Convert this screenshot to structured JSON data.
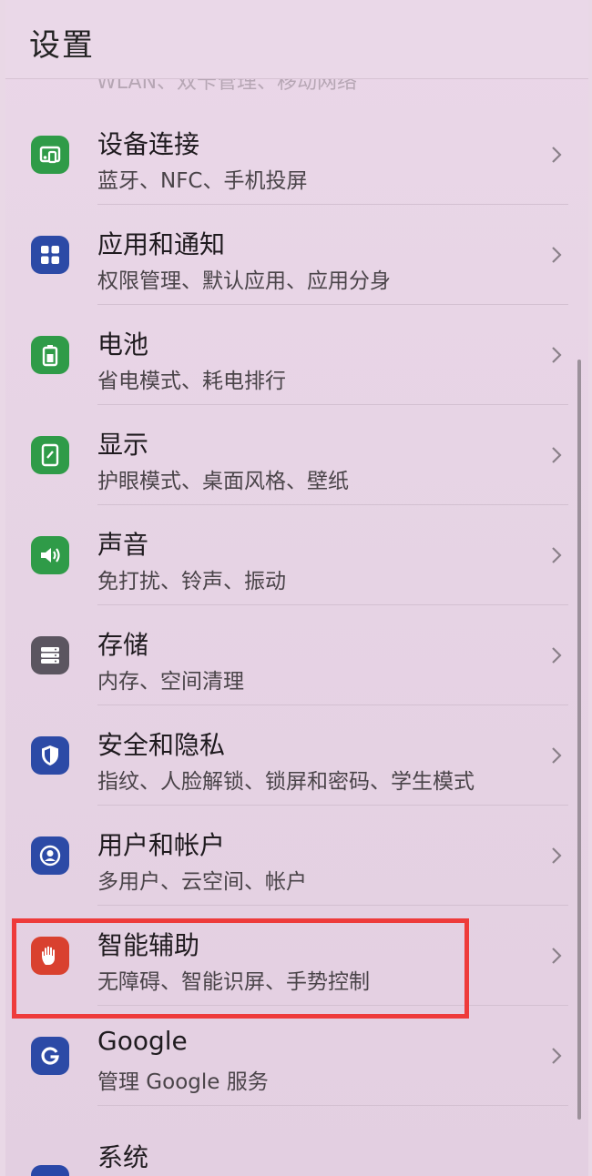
{
  "header": {
    "title": "设置",
    "partial_item": "WLAN、双卡管理、移动网络"
  },
  "items": [
    {
      "title": "设备连接",
      "subtitle": "蓝牙、NFC、手机投屏",
      "icon": "device-connection-icon",
      "color": "#2f9b48"
    },
    {
      "title": "应用和通知",
      "subtitle": "权限管理、默认应用、应用分身",
      "icon": "apps-grid-icon",
      "color": "#2c4aa6"
    },
    {
      "title": "电池",
      "subtitle": "省电模式、耗电排行",
      "icon": "battery-icon",
      "color": "#2f9b48"
    },
    {
      "title": "显示",
      "subtitle": "护眼模式、桌面风格、壁纸",
      "icon": "display-icon",
      "color": "#2f9b48"
    },
    {
      "title": "声音",
      "subtitle": "免打扰、铃声、振动",
      "icon": "sound-icon",
      "color": "#2f9b48"
    },
    {
      "title": "存储",
      "subtitle": "内存、空间清理",
      "icon": "storage-icon",
      "color": "#5b5560"
    },
    {
      "title": "安全和隐私",
      "subtitle": "指纹、人脸解锁、锁屏和密码、学生模式",
      "icon": "shield-icon",
      "color": "#2c4aa6"
    },
    {
      "title": "用户和帐户",
      "subtitle": "多用户、云空间、帐户",
      "icon": "user-account-icon",
      "color": "#2c4aa6"
    },
    {
      "title": "智能辅助",
      "subtitle": "无障碍、智能识屏、手势控制",
      "icon": "hand-icon",
      "color": "#d9412f"
    },
    {
      "title": "Google",
      "subtitle": "管理 Google 服务",
      "icon": "google-icon",
      "color": "#2c4aa6"
    }
  ],
  "last_item": {
    "title": "系统",
    "icon": "system-icon",
    "color": "#2c4aa6"
  },
  "highlight": {
    "target": "智能辅助",
    "color": "#ee3b3b"
  }
}
